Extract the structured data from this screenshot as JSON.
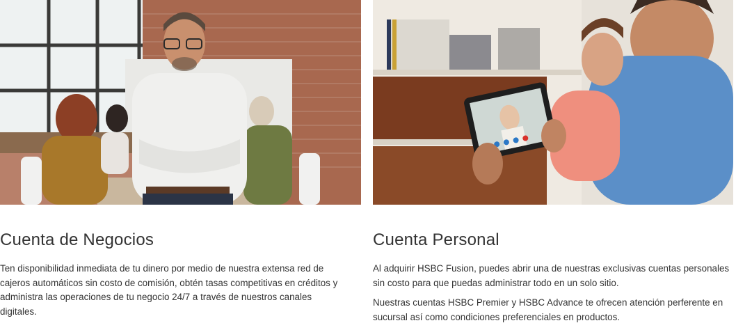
{
  "cards": [
    {
      "title": "Cuenta de Negocios",
      "image_alt": "business-meeting-photo",
      "paragraphs": [
        "Ten disponibilidad inmediata de tu dinero por medio de nuestra extensa red de cajeros automáticos sin costo de comisión, obtén tasas competitivas en créditos y administra las operaciones de tu negocio 24/7 a través de nuestros canales digitales."
      ]
    },
    {
      "title": "Cuenta Personal",
      "image_alt": "family-tablet-video-call-photo",
      "paragraphs": [
        "Al adquirir HSBC Fusion, puedes abrir una de nuestras exclusivas cuentas personales sin costo para que puedas administrar todo en un solo sitio.",
        "Nuestras cuentas HSBC Premier y HSBC Advance te ofrecen atención perferente en sucursal así como condiciones preferenciales en productos."
      ]
    }
  ]
}
